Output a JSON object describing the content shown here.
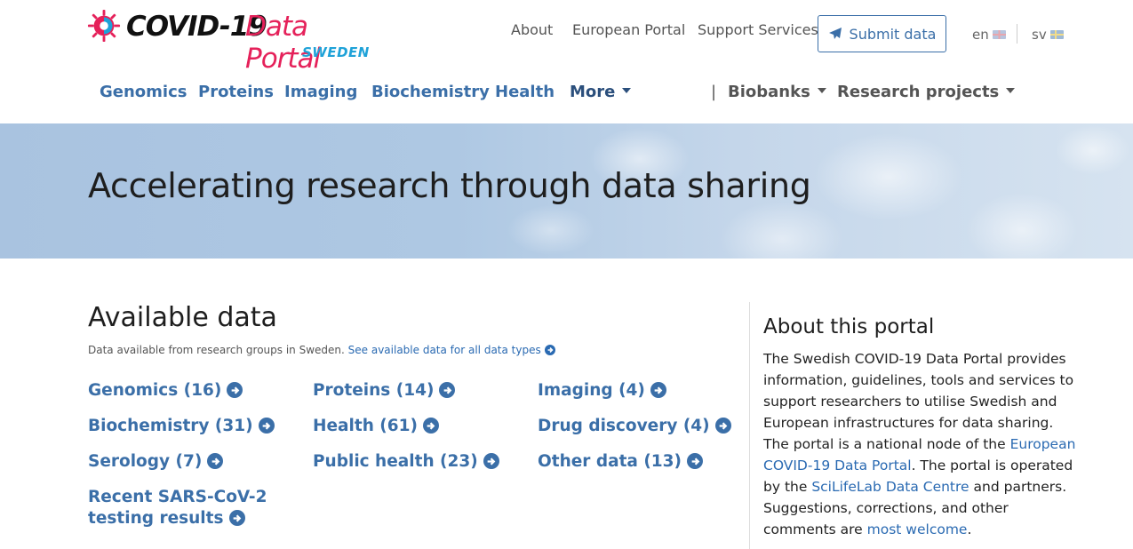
{
  "logo": {
    "covid": "COVID-19",
    "portal": "Data Portal",
    "country": "SWEDEN"
  },
  "topnav": {
    "about": "About",
    "european_portal": "European Portal",
    "support": "Support Services"
  },
  "submit": {
    "label": "Submit data"
  },
  "lang": {
    "en": "en",
    "sv": "sv"
  },
  "mainnav": {
    "genomics": "Genomics",
    "proteins": "Proteins",
    "imaging": "Imaging",
    "biochemistry": "Biochemistry",
    "health": "Health",
    "more": "More",
    "separator": "|",
    "biobanks": "Biobanks",
    "research": "Research projects"
  },
  "hero": {
    "title": "Accelerating research through data sharing"
  },
  "available": {
    "title": "Available data",
    "subtitle": "Data available from research groups in Sweden.",
    "subtitle_link": "See available data for all data types",
    "items": [
      "Genomics (16)",
      "Proteins (14)",
      "Imaging (4)",
      "Biochemistry (31)",
      "Health (61)",
      "Drug discovery (4)",
      "Serology (7)",
      "Public health (23)",
      "Other data (13)",
      "Recent SARS-CoV-2 testing results"
    ]
  },
  "about": {
    "title": "About this portal",
    "t1": "The Swedish COVID-19 Data Portal provides information, guidelines, tools and services to support researchers to utilise Swedish and European infrastructures for data sharing. The portal is a national node of the ",
    "link1": "European COVID-19 Data Portal",
    "t2": ". The portal is operated by the ",
    "link2": "SciLifeLab Data Centre",
    "t3": " and partners. Suggestions, corrections, and other comments are ",
    "link3": "most welcome",
    "t4": "."
  },
  "colors": {
    "link": "#3b6fa8",
    "brand_red": "#e5215a",
    "brand_cyan": "#1fa2d8"
  }
}
